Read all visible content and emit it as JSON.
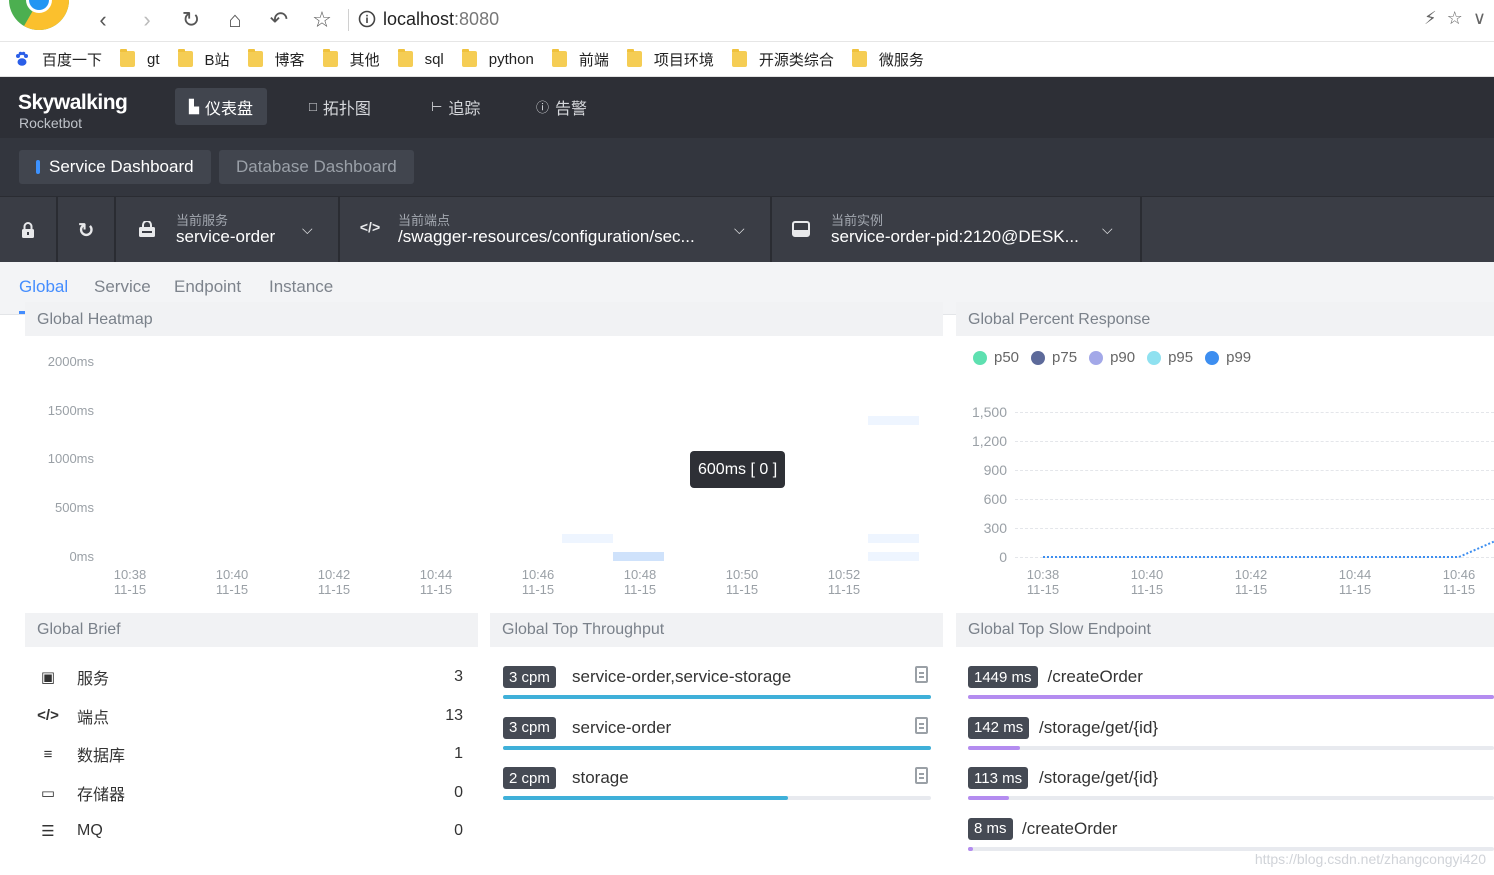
{
  "browser": {
    "url_host": "localhost",
    "url_port": ":8080",
    "bookmarks": [
      {
        "label": "百度一下",
        "icon": "baidu-paw-icon"
      },
      {
        "label": "gt",
        "icon": "folder-icon"
      },
      {
        "label": "B站",
        "icon": "folder-icon"
      },
      {
        "label": "博客",
        "icon": "folder-icon"
      },
      {
        "label": "其他",
        "icon": "folder-icon"
      },
      {
        "label": "sql",
        "icon": "folder-icon"
      },
      {
        "label": "python",
        "icon": "folder-icon"
      },
      {
        "label": "前端",
        "icon": "folder-icon"
      },
      {
        "label": "项目环境",
        "icon": "folder-icon"
      },
      {
        "label": "开源类综合",
        "icon": "folder-icon"
      },
      {
        "label": "微服务",
        "icon": "folder-icon"
      }
    ]
  },
  "app": {
    "logo": "Skywalking",
    "logo_sub": "Rocketbot",
    "nav": [
      {
        "label": "仪表盘",
        "icon": "dashboard-icon",
        "active": true
      },
      {
        "label": "拓扑图",
        "icon": "topology-icon",
        "active": false
      },
      {
        "label": "追踪",
        "icon": "trace-icon",
        "active": false
      },
      {
        "label": "告警",
        "icon": "alarm-icon",
        "active": false
      }
    ],
    "dashboards": [
      {
        "label": "Service Dashboard",
        "active": true
      },
      {
        "label": "Database Dashboard",
        "active": false
      }
    ]
  },
  "selectors": {
    "service": {
      "label": "当前服务",
      "value": "service-order"
    },
    "endpoint": {
      "label": "当前端点",
      "value": "/swagger-resources/configuration/sec..."
    },
    "instance": {
      "label": "当前实例",
      "value": "service-order-pid:2120@DESK..."
    }
  },
  "sub_tabs": [
    "Global",
    "Service",
    "Endpoint",
    "Instance"
  ],
  "panels": {
    "heatmap_title": "Global Heatmap",
    "percent_title": "Global Percent Response",
    "brief_title": "Global Brief",
    "throughput_title": "Global Top Throughput",
    "slow_title": "Global Top Slow Endpoint"
  },
  "heatmap": {
    "y_labels": [
      "2000ms",
      "1500ms",
      "1000ms",
      "500ms",
      "0ms"
    ],
    "x_labels": [
      {
        "time": "10:38",
        "date": "11-15"
      },
      {
        "time": "10:40",
        "date": "11-15"
      },
      {
        "time": "10:42",
        "date": "11-15"
      },
      {
        "time": "10:44",
        "date": "11-15"
      },
      {
        "time": "10:46",
        "date": "11-15"
      },
      {
        "time": "10:48",
        "date": "11-15"
      },
      {
        "time": "10:50",
        "date": "11-15"
      },
      {
        "time": "10:52",
        "date": "11-15"
      }
    ],
    "tooltip": "600ms [ 0 ]"
  },
  "chart_data": {
    "type": "line",
    "title": "Global Percent Response",
    "legend": [
      "p50",
      "p75",
      "p90",
      "p95",
      "p99"
    ],
    "legend_colors": [
      "#5ee0b0",
      "#5d6a9a",
      "#a3a8e8",
      "#8fe1f0",
      "#3d8ef0"
    ],
    "legend_position": "top-left",
    "ylim": [
      0,
      1500
    ],
    "y_ticks": [
      "1,500",
      "1,200",
      "900",
      "600",
      "300",
      "0"
    ],
    "x": [
      {
        "time": "10:38",
        "date": "11-15"
      },
      {
        "time": "10:40",
        "date": "11-15"
      },
      {
        "time": "10:42",
        "date": "11-15"
      },
      {
        "time": "10:44",
        "date": "11-15"
      },
      {
        "time": "10:46",
        "date": "11-15"
      }
    ],
    "series": [
      {
        "name": "p99",
        "values": [
          0,
          0,
          0,
          0,
          0,
          160
        ]
      }
    ]
  },
  "brief": [
    {
      "label": "服务",
      "value": "3",
      "icon": "service-lock-icon"
    },
    {
      "label": "端点",
      "value": "13",
      "icon": "endpoint-code-icon"
    },
    {
      "label": "数据库",
      "value": "1",
      "icon": "database-icon"
    },
    {
      "label": "存储器",
      "value": "0",
      "icon": "cache-icon"
    },
    {
      "label": "MQ",
      "value": "0",
      "icon": "mq-icon"
    }
  ],
  "throughput": [
    {
      "badge": "3 cpm",
      "name": "service-order,service-storage",
      "fill": 1.0
    },
    {
      "badge": "3 cpm",
      "name": "service-order",
      "fill": 1.0
    },
    {
      "badge": "2 cpm",
      "name": "storage",
      "fill": 0.666
    }
  ],
  "slow": [
    {
      "badge": "1449 ms",
      "name": "/createOrder",
      "fill": 1.0
    },
    {
      "badge": "142 ms",
      "name": "/storage/get/{id}",
      "fill": 0.098
    },
    {
      "badge": "113 ms",
      "name": "/storage/get/{id}",
      "fill": 0.078
    },
    {
      "badge": "8 ms",
      "name": "/createOrder",
      "fill": 0.01
    }
  ],
  "colors": {
    "accent": "#448dfe",
    "throughput_bar": "#3fb0d9",
    "slow_bar": "#b48cf0"
  },
  "watermark": "https://blog.csdn.net/zhangcongyi420"
}
